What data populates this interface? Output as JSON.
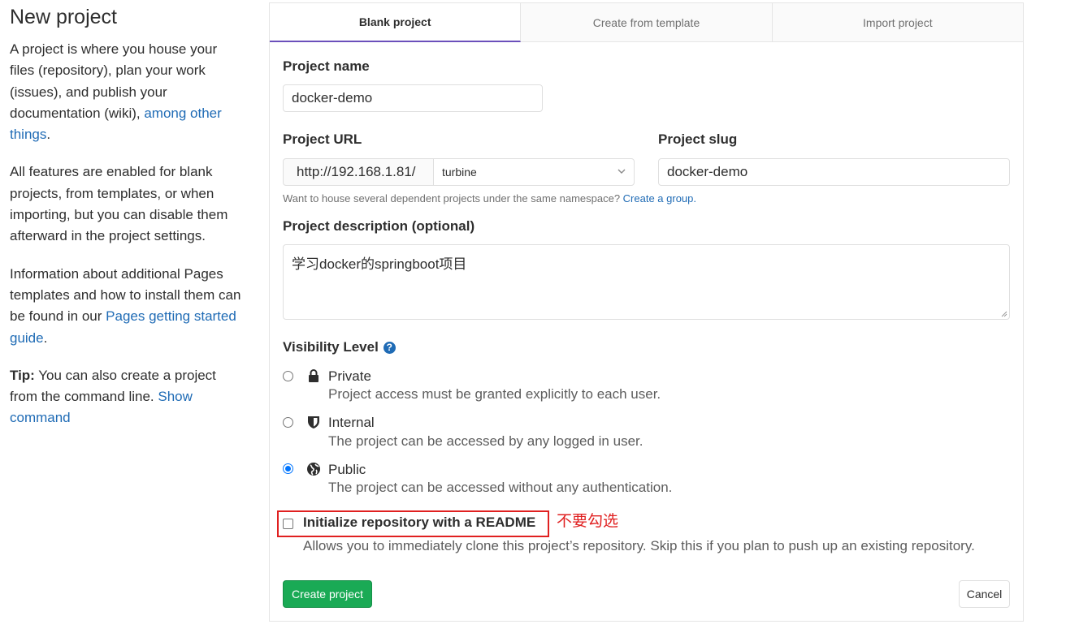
{
  "sidebar": {
    "title": "New project",
    "p1_text": "A project is where you house your files (repository), plan your work (issues), and publish your documentation (wiki), ",
    "p1_link": "among other things",
    "p1_end": ".",
    "p2_text": "All features are enabled for blank projects, from templates, or when importing, but you can disable them afterward in the project settings.",
    "p3_text": "Information about additional Pages templates and how to install them can be found in our ",
    "p3_link": "Pages getting started guide",
    "p3_end": ".",
    "tip_label": "Tip:",
    "tip_text": " You can also create a project from the command line. ",
    "tip_link": "Show command"
  },
  "tabs": [
    "Blank project",
    "Create from template",
    "Import project"
  ],
  "form": {
    "name_label": "Project name",
    "name_value": "docker-demo",
    "url_label": "Project URL",
    "url_prefix": "http://192.168.1.81/",
    "namespace": "turbine",
    "slug_label": "Project slug",
    "slug_value": "docker-demo",
    "help_text": "Want to house several dependent projects under the same namespace? ",
    "help_link": "Create a group.",
    "desc_label": "Project description (optional)",
    "desc_value": "学习docker的springboot项目",
    "visibility_label": "Visibility Level",
    "visibility": [
      {
        "name": "Private",
        "desc": "Project access must be granted explicitly to each user.",
        "icon": "lock-icon",
        "checked": false
      },
      {
        "name": "Internal",
        "desc": "The project can be accessed by any logged in user.",
        "icon": "shield-icon",
        "checked": false
      },
      {
        "name": "Public",
        "desc": "The project can be accessed without any authentication.",
        "icon": "globe-icon",
        "checked": true
      }
    ],
    "readme_label": "Initialize repository with a README",
    "readme_desc": "Allows you to immediately clone this project’s repository. Skip this if you plan to push up an existing repository.",
    "annotation": "不要勾选",
    "create_label": "Create project",
    "cancel_label": "Cancel"
  },
  "colors": {
    "accent": "#6b4fbb",
    "link": "#1f6bb5",
    "success": "#1aaa55",
    "annotation": "#e02020"
  }
}
